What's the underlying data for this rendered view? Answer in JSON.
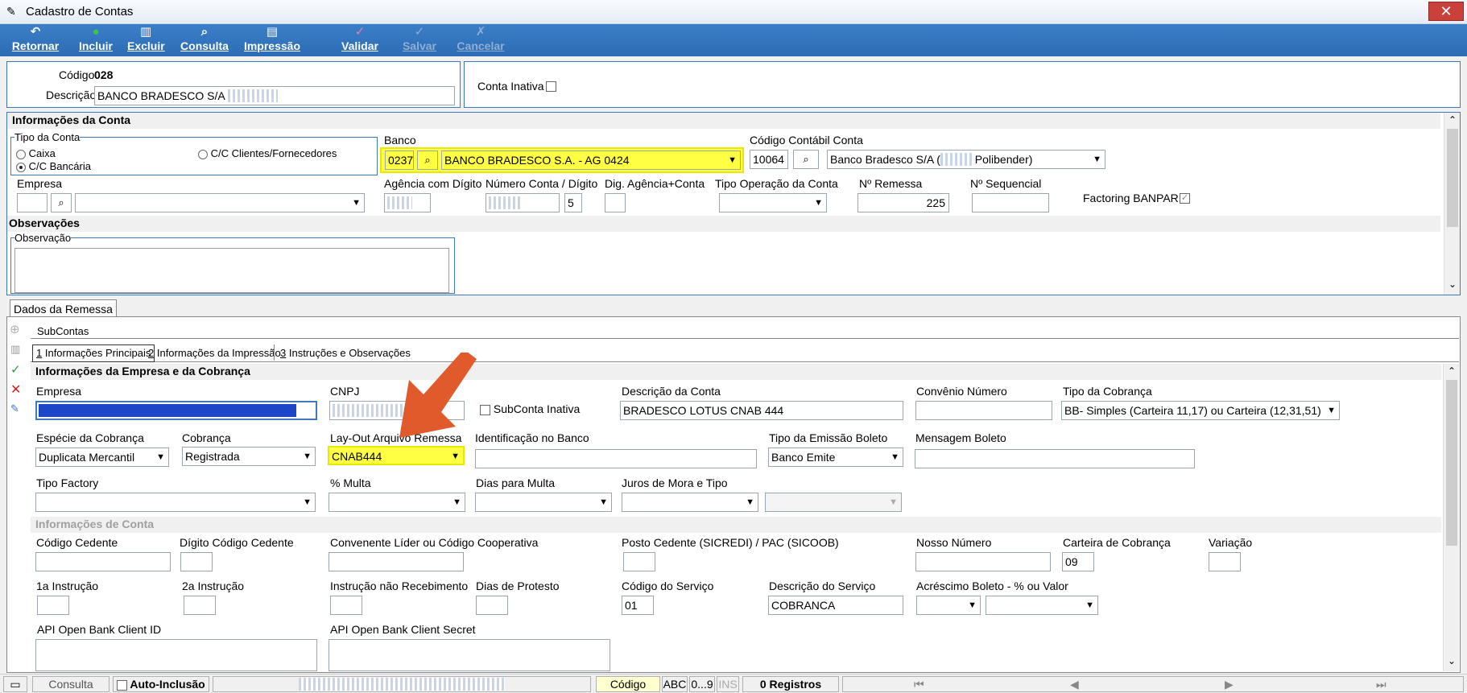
{
  "window": {
    "title": "Cadastro de Contas",
    "close": "✕"
  },
  "toolbar": [
    {
      "id": "retornar",
      "label": "Retornar",
      "icon": "back-icon",
      "glyph": "↶",
      "enabled": true
    },
    {
      "id": "incluir",
      "label": "Incluir",
      "icon": "add-icon",
      "glyph": "●",
      "enabled": true
    },
    {
      "id": "excluir",
      "label": "Excluir",
      "icon": "trash-icon",
      "glyph": "▥",
      "enabled": true
    },
    {
      "id": "consulta",
      "label": "Consulta",
      "icon": "search-icon",
      "glyph": "⌕",
      "enabled": true
    },
    {
      "id": "impressao",
      "label": "Impressão",
      "icon": "printer-icon",
      "glyph": "▤",
      "enabled": true
    },
    {
      "id": "validar",
      "label": "Validar",
      "icon": "validate-icon",
      "glyph": "✓",
      "enabled": true
    },
    {
      "id": "salvar",
      "label": "Salvar",
      "icon": "check-icon",
      "glyph": "✓",
      "enabled": false
    },
    {
      "id": "cancelar",
      "label": "Cancelar",
      "icon": "cancel-icon",
      "glyph": "✗",
      "enabled": false
    }
  ],
  "header": {
    "codigo_label": "Código",
    "codigo_value": "028",
    "descricao_label": "Descrição",
    "descricao_value": "BANCO BRADESCO S/A",
    "conta_inativa_label": "Conta Inativa"
  },
  "info_conta": {
    "title": "Informações da Conta",
    "tipo_conta_label": "Tipo da Conta",
    "tipo_options": [
      "Caixa",
      "C/C Bancária",
      "C/C Clientes/Fornecedores"
    ],
    "tipo_selected": "C/C Bancária",
    "banco_label": "Banco",
    "banco_code": "0237",
    "banco_name": "BANCO BRADESCO S.A. - AG 0424",
    "cod_contabil_label": "Código Contábil Conta",
    "cod_contabil_value": "10064",
    "cod_contabil_name": "Banco Bradesco S/A (",
    "cod_contabil_suffix": "Polibender)",
    "empresa_label": "Empresa",
    "agencia_label": "Agência com Dígito",
    "numero_label": "Número Conta / Dígito",
    "numero_digito": "5",
    "dig_label": "Dig. Agência+Conta",
    "tipo_operacao_label": "Tipo Operação da Conta",
    "remessa_label": "Nº Remessa",
    "remessa_value": "225",
    "sequencial_label": "Nº Sequencial",
    "factoring_label": "Factoring BANPAR",
    "obs_section": "Observações",
    "obs_label": "Observação"
  },
  "tabs": {
    "dados_remessa": "Dados da Remessa",
    "subcontas": "SubContas",
    "sub": [
      {
        "key": "1",
        "label": " Informações Principais"
      },
      {
        "key": "2",
        "label": " Informações da Impressão"
      },
      {
        "key": "3",
        "label": " Instruções e Observações"
      }
    ]
  },
  "empresa_cobranca": {
    "title": "Informações da Empresa e da Cobrança",
    "empresa_label": "Empresa",
    "cnpj_label": "CNPJ",
    "subconta_inativa": "SubConta Inativa",
    "descricao_conta_label": "Descrição da Conta",
    "descricao_conta_value": "BRADESCO LOTUS CNAB 444",
    "convenio_label": "Convênio Número",
    "tipo_cobranca_label": "Tipo da Cobrança",
    "tipo_cobranca_value": "BB- Simples (Carteira 11,17) ou Carteira (12,31,51)",
    "especie_label": "Espécie da Cobrança",
    "especie_value": "Duplicata Mercantil",
    "cobranca_label": "Cobrança",
    "cobranca_value": "Registrada",
    "layout_label": "Lay-Out Arquivo Remessa",
    "layout_value": "CNAB444",
    "ident_banco_label": "Identificação no Banco",
    "tipo_emissao_label": "Tipo da Emissão Boleto",
    "tipo_emissao_value": "Banco Emite",
    "mensagem_label": "Mensagem Boleto",
    "tipo_factory_label": "Tipo Factory",
    "multa_label": "% Multa",
    "dias_multa_label": "Dias para Multa",
    "juros_label": "Juros de Mora e Tipo"
  },
  "info_de_conta": {
    "title": "Informações de Conta",
    "cod_cedente": "Código Cedente",
    "dig_cedente": "Dígito Código Cedente",
    "convenente": "Convenente Líder ou Código Cooperativa",
    "posto": "Posto Cedente (SICREDI) / PAC  (SICOOB)",
    "nosso_numero": "Nosso Número",
    "carteira_label": "Carteira de Cobrança",
    "carteira_value": "09",
    "variacao": "Variação",
    "instr1": "1a Instrução",
    "instr2": "2a Instrução",
    "instr_nao": "Instrução não Recebimento",
    "dias_protesto": "Dias de Protesto",
    "cod_servico_label": "Código do Serviço",
    "cod_servico_value": "01",
    "desc_servico_label": "Descrição do Serviço",
    "desc_servico_value": "COBRANCA",
    "acrescimo_label": "Acréscimo Boleto - % ou Valor",
    "api_id": "API Open Bank Client ID",
    "api_secret": "API Open Bank Client Secret"
  },
  "status": {
    "consulta": "Consulta",
    "auto_inclusao": "Auto-Inclusão",
    "field": "Código",
    "abc": "ABC",
    "digits": "0...9",
    "ins": "INS",
    "registros": "0 Registros"
  },
  "colors": {
    "toolbar": "#2c6cb4",
    "highlight": "#ffff44",
    "arrow": "#e05a2b",
    "panel_border": "#3d78c0"
  }
}
